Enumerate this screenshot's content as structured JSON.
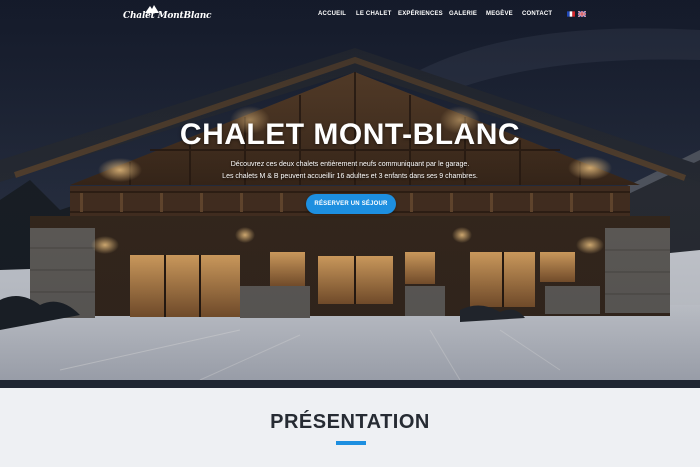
{
  "brand": {
    "logo_text": "Chalet MontBlanc"
  },
  "nav": {
    "items": [
      {
        "label": "ACCUEIL"
      },
      {
        "label": "LE CHALET"
      },
      {
        "label": "EXPÉRIENCES"
      },
      {
        "label": "GALERIE"
      },
      {
        "label": "MEGÈVE"
      },
      {
        "label": "CONTACT"
      }
    ],
    "languages": [
      "fr-flag-icon",
      "uk-flag-icon"
    ]
  },
  "hero": {
    "title": "CHALET MONT-BLANC",
    "line1": "Découvrez ces deux chalets entièrement neufs communiquant par le garage.",
    "line2": "Les chalets M & B peuvent accueillir 16 adultes et 3 enfants dans ses 9 chambres.",
    "cta_label": "RÉSERVER UN SÉJOUR",
    "accent_color": "#1d8fe0"
  },
  "presentation": {
    "title": "PRÉSENTATION"
  }
}
